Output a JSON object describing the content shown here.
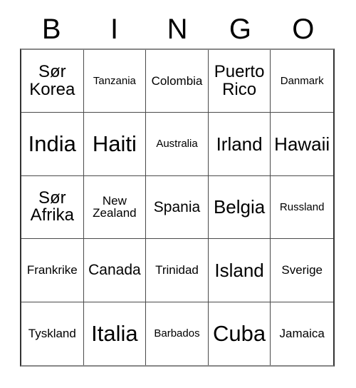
{
  "card": {
    "headers": [
      "B",
      "I",
      "N",
      "G",
      "O"
    ],
    "rows": [
      [
        {
          "label": "Sør\nKorea",
          "size": "t-wrap"
        },
        {
          "label": "Tanzania",
          "size": "t-xs"
        },
        {
          "label": "Colombia",
          "size": "t-sm"
        },
        {
          "label": "Puerto\nRico",
          "size": "t-wrap"
        },
        {
          "label": "Danmark",
          "size": "t-xs"
        }
      ],
      [
        {
          "label": "India",
          "size": "t-xl"
        },
        {
          "label": "Haiti",
          "size": "t-xl"
        },
        {
          "label": "Australia",
          "size": "t-xs"
        },
        {
          "label": "Irland",
          "size": "t-lg"
        },
        {
          "label": "Hawaii",
          "size": "t-lg"
        }
      ],
      [
        {
          "label": "Sør\nAfrika",
          "size": "t-wrap"
        },
        {
          "label": "New\nZealand",
          "size": "t-sm"
        },
        {
          "label": "Spania",
          "size": "t-md"
        },
        {
          "label": "Belgia",
          "size": "t-lg"
        },
        {
          "label": "Russland",
          "size": "t-xs"
        }
      ],
      [
        {
          "label": "Frankrike",
          "size": "t-sm"
        },
        {
          "label": "Canada",
          "size": "t-md"
        },
        {
          "label": "Trinidad",
          "size": "t-sm"
        },
        {
          "label": "Island",
          "size": "t-lg"
        },
        {
          "label": "Sverige",
          "size": "t-sm"
        }
      ],
      [
        {
          "label": "Tyskland",
          "size": "t-sm"
        },
        {
          "label": "Italia",
          "size": "t-xl"
        },
        {
          "label": "Barbados",
          "size": "t-xs"
        },
        {
          "label": "Cuba",
          "size": "t-xl"
        },
        {
          "label": "Jamaica",
          "size": "t-sm"
        }
      ]
    ]
  },
  "colors": {
    "background": "#ffffff",
    "text": "#000000",
    "grid_line": "#4a4a4a",
    "grid_outer": "#333333"
  }
}
